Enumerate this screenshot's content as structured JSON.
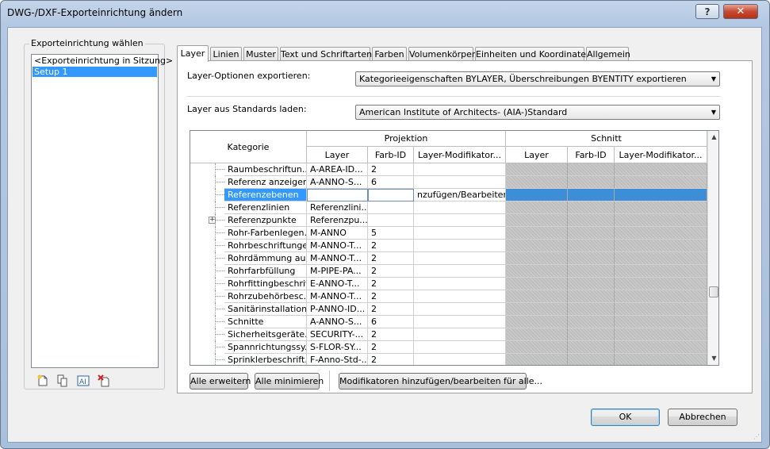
{
  "window": {
    "title": "DWG-/DXF-Exporteinrichtung ändern",
    "help_label": "?",
    "close_label": "✕"
  },
  "left_panel": {
    "title": "Exporteinrichtung wählen",
    "items": [
      "<Exporteinrichtung in Sitzung>",
      "Setup 1"
    ],
    "icons": [
      "new-setup-icon",
      "duplicate-setup-icon",
      "rename-setup-icon",
      "delete-setup-icon"
    ]
  },
  "tabs": [
    "Layer",
    "Linien",
    "Muster",
    "Text und Schriftarten",
    "Farben",
    "Volumenkörper",
    "Einheiten und Koordinaten",
    "Allgemein"
  ],
  "layer_options": {
    "label": "Layer-Optionen exportieren:",
    "value": "Kategorieeigenschaften BYLAYER, Überschreibungen  BYENTITY exportieren"
  },
  "standards": {
    "label": "Layer aus Standards laden:",
    "value": "American Institute of Architects- (AIA-)Standard"
  },
  "grid": {
    "header_kategorie": "Kategorie",
    "header_projektion": "Projektion",
    "header_schnitt": "Schnitt",
    "sub_layer": "Layer",
    "sub_farb": "Farb-ID",
    "sub_mod": "Layer-Modifikator...",
    "rows": [
      {
        "cat": "Raumbeschriftun...",
        "layer": "A-AREA-ID...",
        "farb": "2",
        "mod": ""
      },
      {
        "cat": "Referenz anzeigen",
        "layer": "A-ANNO-S...",
        "farb": "6",
        "mod": ""
      },
      {
        "cat": "Referenzebenen",
        "layer": "",
        "farb": "",
        "mod": "nzufügen/Bearbeiten"
      },
      {
        "cat": "Referenzlinien",
        "layer": "Referenzlini...",
        "farb": "",
        "mod": ""
      },
      {
        "cat": "Referenzpunkte",
        "layer": "Referenzpu...",
        "farb": "",
        "mod": ""
      },
      {
        "cat": "Rohr-Farbenlegen...",
        "layer": "M-ANNO",
        "farb": "5",
        "mod": ""
      },
      {
        "cat": "Rohrbeschriftungen",
        "layer": "M-ANNO-T...",
        "farb": "2",
        "mod": ""
      },
      {
        "cat": "Rohrdämmung au...",
        "layer": "M-ANNO-T...",
        "farb": "2",
        "mod": ""
      },
      {
        "cat": "Rohrfarbfüllung",
        "layer": "M-PIPE-PA...",
        "farb": "2",
        "mod": ""
      },
      {
        "cat": "Rohrfittingbeschrif...",
        "layer": "E-ANNO-T...",
        "farb": "2",
        "mod": ""
      },
      {
        "cat": "Rohrzubehörbesc...",
        "layer": "M-ANNO-T...",
        "farb": "2",
        "mod": ""
      },
      {
        "cat": "Sanitärinstallation...",
        "layer": "P-ANNO-ID...",
        "farb": "2",
        "mod": ""
      },
      {
        "cat": "Schnitte",
        "layer": "A-ANNO-S...",
        "farb": "6",
        "mod": ""
      },
      {
        "cat": "Sicherheitsgeräte...",
        "layer": "SECURITY-...",
        "farb": "2",
        "mod": ""
      },
      {
        "cat": "Spannrichtungssy...",
        "layer": "S-FLOR-SY...",
        "farb": "2",
        "mod": ""
      },
      {
        "cat": "Sprinklerbeschrift...",
        "layer": "F-Anno-Std-...",
        "farb": "2",
        "mod": ""
      }
    ]
  },
  "buttons": {
    "expand_all": "Alle erweitern",
    "collapse_all": "Alle  minimieren",
    "modifiers_all": "Modifikatoren hinzufügen/bearbeiten für alle...",
    "ok": "OK",
    "cancel": "Abbrechen"
  }
}
